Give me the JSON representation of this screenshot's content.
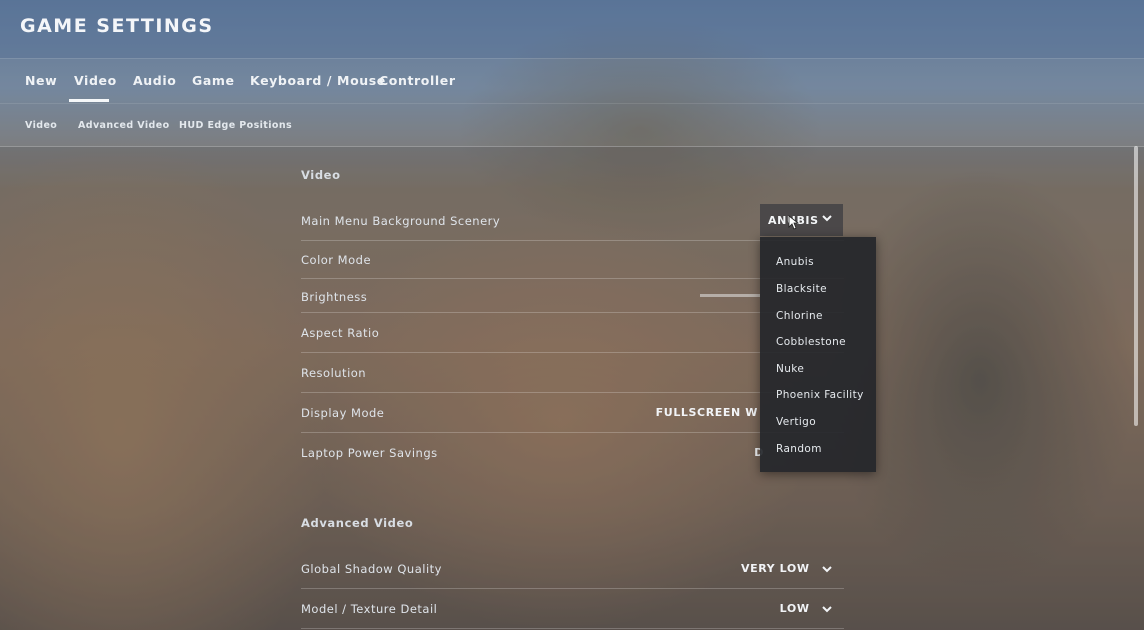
{
  "header": {
    "title": "GAME SETTINGS"
  },
  "tabs": [
    {
      "label": "New"
    },
    {
      "label": "Video",
      "active": true
    },
    {
      "label": "Audio"
    },
    {
      "label": "Game"
    },
    {
      "label": "Keyboard / Mouse"
    },
    {
      "label": "Controller"
    }
  ],
  "subtabs": [
    {
      "label": "Video"
    },
    {
      "label": "Advanced Video"
    },
    {
      "label": "HUD Edge Positions"
    }
  ],
  "sections": {
    "video": {
      "title": "Video",
      "rows": [
        {
          "label": "Main Menu Background Scenery",
          "value": "ANUBIS"
        },
        {
          "label": "Color Mode",
          "value": ""
        },
        {
          "label": "Brightness",
          "value": ""
        },
        {
          "label": "Aspect Ratio",
          "value": ""
        },
        {
          "label": "Resolution",
          "value": ""
        },
        {
          "label": "Display Mode",
          "value": "FULLSCREEN W"
        },
        {
          "label": "Laptop Power Savings",
          "value": "D"
        }
      ]
    },
    "advanced": {
      "title": "Advanced Video",
      "rows": [
        {
          "label": "Global Shadow Quality",
          "value": "VERY LOW"
        },
        {
          "label": "Model / Texture Detail",
          "value": "LOW"
        }
      ]
    }
  },
  "dropdown": {
    "options": [
      "Anubis",
      "Blacksite",
      "Chlorine",
      "Cobblestone",
      "Nuke",
      "Phoenix Facility",
      "Vertigo",
      "Random"
    ]
  },
  "icons": {
    "chevron": "chevron-down-icon",
    "cursor": "mouse-cursor-icon"
  }
}
